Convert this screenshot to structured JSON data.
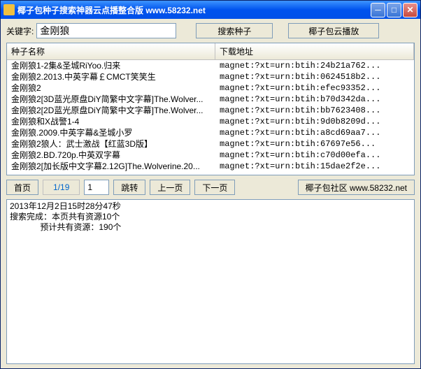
{
  "window": {
    "title": "椰子包种子搜索神器云点播整合版  www.58232.net"
  },
  "search": {
    "label": "关键字:",
    "value": "金刚狼",
    "btn_search": "搜索种子",
    "btn_play": "椰子包云播放"
  },
  "list": {
    "col_name": "种子名称",
    "col_url": "下载地址",
    "rows": [
      {
        "name": "金刚狼1-2集&圣城RiYoo.归来",
        "url": "magnet:?xt=urn:btih:24b21a762..."
      },
      {
        "name": "金刚狼2.2013.中英字幕￡CMCT笑笑生",
        "url": "magnet:?xt=urn:btih:0624518b2..."
      },
      {
        "name": "金刚狼2",
        "url": "magnet:?xt=urn:btih:efec93352..."
      },
      {
        "name": "金刚狼2[3D蓝光原盘DiY简繁中文字幕]The.Wolver...",
        "url": "magnet:?xt=urn:btih:b70d342da..."
      },
      {
        "name": "金刚狼2[2D蓝光原盘DiY简繁中文字幕]The.Wolver...",
        "url": "magnet:?xt=urn:btih:bb7623408..."
      },
      {
        "name": "金刚狼和X战警1-4",
        "url": "magnet:?xt=urn:btih:9d0b8209d..."
      },
      {
        "name": "金刚狼.2009.中英字幕&圣城小罗",
        "url": "magnet:?xt=urn:btih:a8cd69aa7..."
      },
      {
        "name": "金刚狼2狼人：武士激战【红蓝3D版】",
        "url": "magnet:?xt=urn:btih:67697e56..."
      },
      {
        "name": "金刚狼2.BD.720p.中英双字幕",
        "url": "magnet:?xt=urn:btih:c70d00efa..."
      },
      {
        "name": "金刚狼2[加长版中文字幕2.12G]The.Wolverine.20...",
        "url": "magnet:?xt=urn:btih:15dae2f2e..."
      }
    ]
  },
  "pager": {
    "first": "首页",
    "info": "1/19",
    "page_value": "1",
    "jump": "跳转",
    "prev": "上一页",
    "next": "下一页",
    "community": "椰子包社区 www.58232.net"
  },
  "log": {
    "l1": "2013年12月2日15时28分47秒",
    "l2": "搜索完成：本页共有资源10个",
    "l3": "             预计共有资源：190个"
  }
}
